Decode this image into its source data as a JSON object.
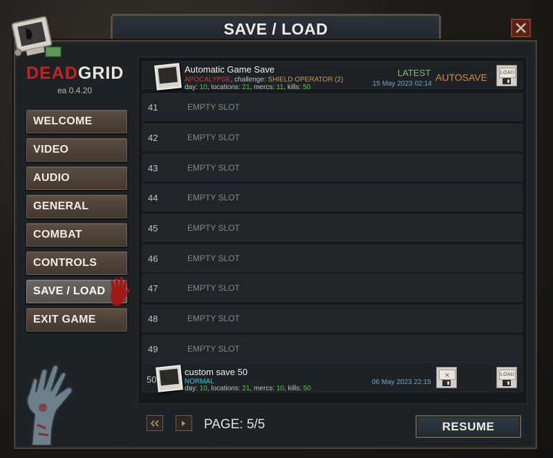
{
  "window": {
    "title": "SAVE / LOAD",
    "close_label": "X"
  },
  "logo": {
    "dead": "DEAD",
    "grid": "GRID",
    "version": "ea 0.4.20"
  },
  "menu": [
    {
      "label": "WELCOME",
      "active": false
    },
    {
      "label": "VIDEO",
      "active": false
    },
    {
      "label": "AUDIO",
      "active": false
    },
    {
      "label": "GENERAL",
      "active": false
    },
    {
      "label": "COMBAT",
      "active": false
    },
    {
      "label": "CONTROLS",
      "active": false
    },
    {
      "label": "SAVE / LOAD",
      "active": true
    },
    {
      "label": "EXIT GAME",
      "active": false
    }
  ],
  "autosave": {
    "title": "Automatic Game Save",
    "difficulty": "APOCALYPSE",
    "challenge_label": "challenge:",
    "challenge": "SHIELD OPERATOR (2)",
    "day_label": "day:",
    "day": "10",
    "locations_label": "locations:",
    "locations": "21",
    "mercs_label": "mercs:",
    "mercs": "11",
    "kills_label": "kills:",
    "kills": "50",
    "latest": "LATEST",
    "date": "15 May 2023 02:14",
    "tag": "AUTOSAVE",
    "load_label": "LOAD"
  },
  "slots": [
    {
      "number": "41",
      "label": "EMPTY SLOT"
    },
    {
      "number": "42",
      "label": "EMPTY SLOT"
    },
    {
      "number": "43",
      "label": "EMPTY SLOT"
    },
    {
      "number": "44",
      "label": "EMPTY SLOT"
    },
    {
      "number": "45",
      "label": "EMPTY SLOT"
    },
    {
      "number": "46",
      "label": "EMPTY SLOT"
    },
    {
      "number": "47",
      "label": "EMPTY SLOT"
    },
    {
      "number": "48",
      "label": "EMPTY SLOT"
    },
    {
      "number": "49",
      "label": "EMPTY SLOT"
    }
  ],
  "custom_save": {
    "number": "50",
    "title": "custom save 50",
    "difficulty": "NORMAL",
    "day_label": "day:",
    "day": "10",
    "locations_label": "locations:",
    "locations": "21",
    "mercs_label": "mercs:",
    "mercs": "10",
    "kills_label": "kills:",
    "kills": "50",
    "date": "06 May 2023 22:15",
    "delete_label": "DELETE",
    "load_label": "LOAD"
  },
  "pager": {
    "prev_icon": "double-left-arrow",
    "next_icon": "right-arrow",
    "label": "PAGE: 5/5"
  },
  "resume_label": "RESUME",
  "colors": {
    "accent_red": "#c9231e",
    "value_green": "#5ec44a",
    "challenge_orange": "#e6942a",
    "normal_cyan": "#3cc7d8",
    "date_blue": "#6aa9d8"
  }
}
